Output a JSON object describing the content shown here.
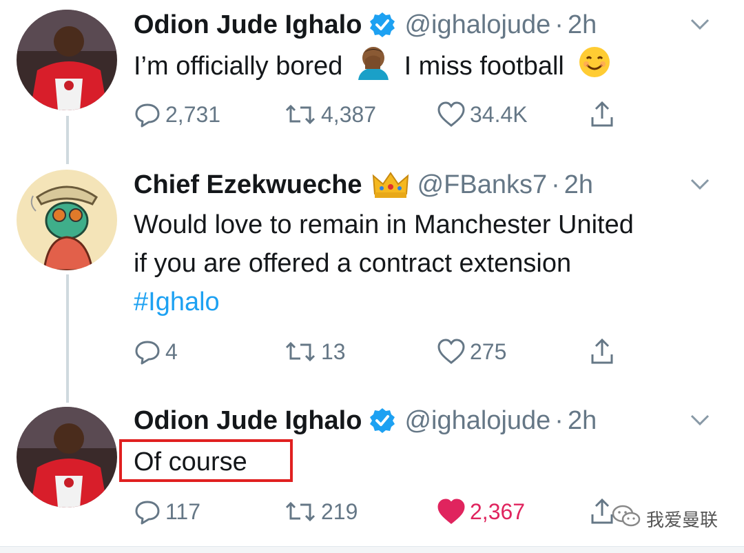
{
  "tweets": [
    {
      "name": "Odion Jude Ighalo",
      "verified": true,
      "handle": "@ighalojude",
      "dot": "·",
      "time": "2h",
      "text_before_emoji": "I’m officially bored",
      "text_after_emoji": "I miss football",
      "reply_count": "2,731",
      "retweet_count": "4,387",
      "like_count": "34.4K",
      "liked": false
    },
    {
      "name": "Chief Ezekwueche",
      "badge_icon": "crown-emoji",
      "handle": "@FBanks7",
      "dot": "·",
      "time": "2h",
      "text_lines": [
        "Would love to remain in Manchester United",
        "if you are offered a contract extension"
      ],
      "hashtag": "#Ighalo",
      "reply_count": "4",
      "retweet_count": "13",
      "like_count": "275",
      "liked": false
    },
    {
      "name": "Odion Jude Ighalo",
      "verified": true,
      "handle": "@ighalojude",
      "dot": "·",
      "time": "2h",
      "text": "Of course",
      "reply_count": "117",
      "retweet_count": "219",
      "like_count": "2,367",
      "liked": true
    }
  ],
  "watermark": {
    "label": "我爱曼联",
    "icon": "wechat-icon"
  },
  "colors": {
    "verified_blue": "#1da1f2",
    "like_red": "#e0245e",
    "muted_gray": "#657786",
    "highlight_red": "#e02020"
  }
}
